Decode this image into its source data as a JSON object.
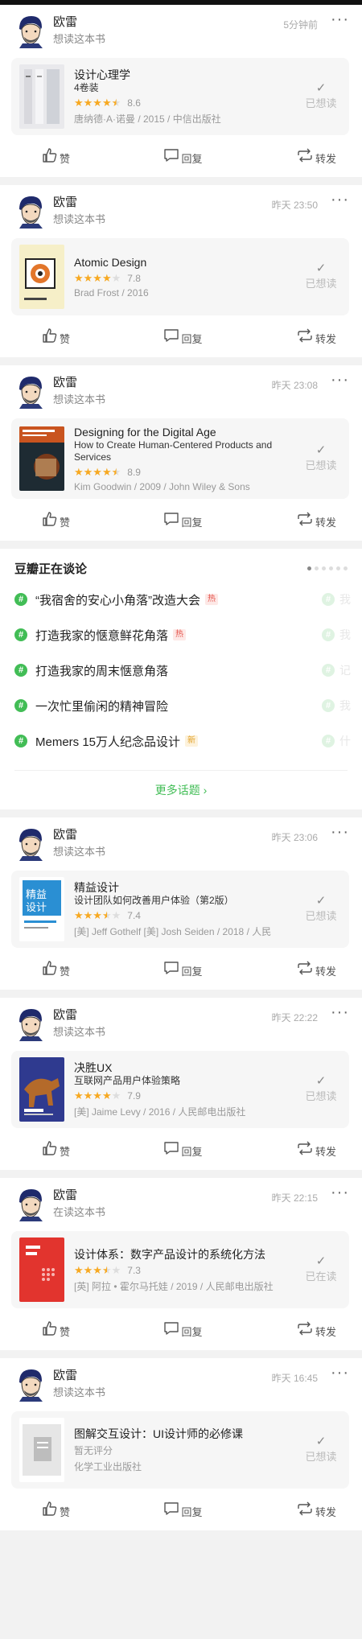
{
  "posts": [
    {
      "user": "欧雷",
      "action": "想读这本书",
      "time": "5分钟前",
      "title": "设计心理学",
      "subtitle": "4卷装",
      "stars": 4.5,
      "score": "8.6",
      "meta": "唐纳德·A·诺曼 / 2015 / 中信出版社",
      "status": "已想读",
      "cover": "c1"
    },
    {
      "user": "欧雷",
      "action": "想读这本书",
      "time": "昨天 23:50",
      "title": "Atomic Design",
      "subtitle": "",
      "stars": 4,
      "score": "7.8",
      "meta": "Brad Frost / 2016",
      "status": "已想读",
      "cover": "c2"
    },
    {
      "user": "欧雷",
      "action": "想读这本书",
      "time": "昨天 23:08",
      "title": "Designing for the Digital Age",
      "subtitle": "How to Create Human-Centered Products and Services",
      "stars": 4.5,
      "score": "8.9",
      "meta": "Kim Goodwin / 2009 / John Wiley & Sons",
      "status": "已想读",
      "cover": "c3"
    },
    {
      "user": "欧雷",
      "action": "想读这本书",
      "time": "昨天 23:06",
      "title": "精益设计",
      "subtitle": "设计团队如何改善用户体验（第2版）",
      "stars": 3.5,
      "score": "7.4",
      "meta": "[美] Jeff Gothelf [美] Josh Seiden / 2018 / 人民",
      "status": "已想读",
      "cover": "c4"
    },
    {
      "user": "欧雷",
      "action": "想读这本书",
      "time": "昨天 22:22",
      "title": "决胜UX",
      "subtitle": "互联网产品用户体验策略",
      "stars": 4,
      "score": "7.9",
      "meta": "[美] Jaime Levy / 2016 / 人民邮电出版社",
      "status": "已想读",
      "cover": "c5"
    },
    {
      "user": "欧雷",
      "action": "在读这本书",
      "time": "昨天 22:15",
      "title": "设计体系：数字产品设计的系统化方法",
      "subtitle": "",
      "stars": 3.5,
      "score": "7.3",
      "meta": "[英] 阿拉 • 霍尔马托娃 / 2019 / 人民邮电出版社",
      "status": "已在读",
      "cover": "c6"
    },
    {
      "user": "欧雷",
      "action": "想读这本书",
      "time": "昨天 16:45",
      "title": "图解交互设计：UI设计师的必修课",
      "subtitle": "",
      "stars": 0,
      "score": "",
      "noRating": "暂无评分",
      "meta": "化学工业出版社",
      "status": "已想读",
      "cover": "c7"
    }
  ],
  "actions": {
    "like": "赞",
    "reply": "回复",
    "share": "转发"
  },
  "trending": {
    "title": "豆瓣正在谈论",
    "topics": [
      {
        "text": "“我宿舍的安心小角落”改造大会",
        "tag": "热",
        "tagType": "hot",
        "ghost": "我"
      },
      {
        "text": "打造我家的惬意鲜花角落",
        "tag": "热",
        "tagType": "hot",
        "ghost": "我"
      },
      {
        "text": "打造我家的周末惬意角落",
        "tag": "",
        "tagType": "",
        "ghost": "记"
      },
      {
        "text": "一次忙里偷闲的精神冒险",
        "tag": "",
        "tagType": "",
        "ghost": "我"
      },
      {
        "text": "Memers    15万人纪念品设计",
        "tag": "新",
        "tagType": "new",
        "ghost": "什"
      }
    ],
    "more": "更多话题 ›"
  },
  "colors": {
    "accent": "#42bd56",
    "star": "#f7a922",
    "hot": "#e5534b"
  }
}
